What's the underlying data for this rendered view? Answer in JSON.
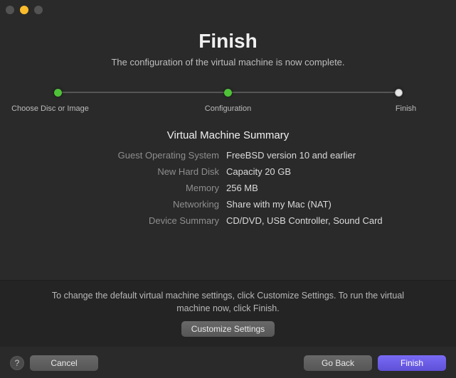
{
  "header": {
    "title": "Finish",
    "subtitle": "The configuration of the virtual machine is now complete."
  },
  "steps": {
    "labels": [
      "Choose Disc\nor Image",
      "Configuration",
      "Finish"
    ]
  },
  "summary": {
    "title": "Virtual Machine Summary",
    "rows": [
      {
        "k": "Guest Operating System",
        "v": "FreeBSD version 10 and earlier"
      },
      {
        "k": "New Hard Disk",
        "v": "Capacity 20 GB"
      },
      {
        "k": "Memory",
        "v": "256 MB"
      },
      {
        "k": "Networking",
        "v": "Share with my Mac (NAT)"
      },
      {
        "k": "Device Summary",
        "v": "CD/DVD, USB Controller, Sound Card"
      }
    ]
  },
  "hint": {
    "text": "To change the default virtual machine settings, click Customize Settings. To run the virtual machine now, click Finish.",
    "customize_label": "Customize Settings"
  },
  "footer": {
    "help_label": "?",
    "cancel_label": "Cancel",
    "back_label": "Go Back",
    "finish_label": "Finish"
  }
}
